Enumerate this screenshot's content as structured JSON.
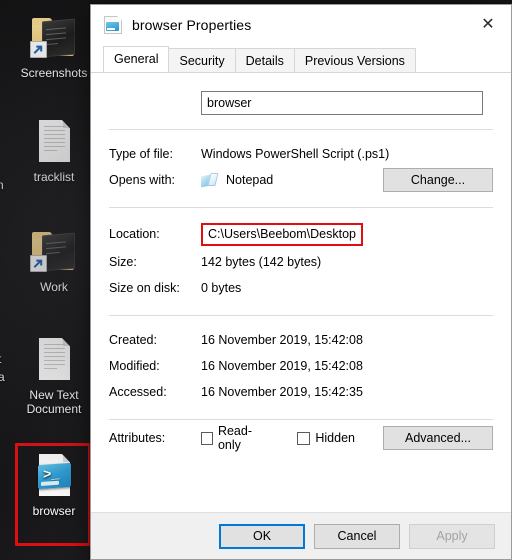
{
  "desktop": {
    "icons": [
      {
        "label": "Screenshots",
        "type": "folder-shortcut"
      },
      {
        "label": "tracklist",
        "type": "text-document"
      },
      {
        "label": "Work",
        "type": "folder-shortcut"
      },
      {
        "label": "New Text Document",
        "type": "text-document"
      },
      {
        "label": "browser",
        "type": "powershell-script",
        "highlighted": true
      }
    ],
    "edge_fragments": [
      "n",
      "t",
      "a"
    ],
    "highlight_color": "#e00e13"
  },
  "dialog": {
    "title": "browser Properties",
    "close_label": "✕",
    "tabs": [
      {
        "label": "General",
        "active": true
      },
      {
        "label": "Security",
        "active": false
      },
      {
        "label": "Details",
        "active": false
      },
      {
        "label": "Previous Versions",
        "active": false
      }
    ],
    "general": {
      "name_value": "browser",
      "rows": [
        {
          "label": "Type of file:",
          "value": "Windows PowerShell Script (.ps1)"
        },
        {
          "label": "Opens with:",
          "value": "Notepad"
        },
        {
          "label": "Location:",
          "value": "C:\\Users\\Beebom\\Desktop"
        },
        {
          "label": "Size:",
          "value": "142 bytes (142 bytes)"
        },
        {
          "label": "Size on disk:",
          "value": "0 bytes"
        },
        {
          "label": "Created:",
          "value": "16 November 2019, 15:42:08"
        },
        {
          "label": "Modified:",
          "value": "16 November 2019, 15:42:08"
        },
        {
          "label": "Accessed:",
          "value": "16 November 2019, 15:42:35"
        },
        {
          "label": "Attributes:",
          "value": ""
        }
      ],
      "change_button": "Change...",
      "advanced_button": "Advanced...",
      "read_only_label": "Read-only",
      "read_only_checked": false,
      "hidden_label": "Hidden",
      "hidden_checked": false,
      "location_highlighted": true
    },
    "footer": {
      "ok": "OK",
      "cancel": "Cancel",
      "apply": "Apply",
      "apply_disabled": true
    },
    "accent_color": "#0078d7"
  }
}
